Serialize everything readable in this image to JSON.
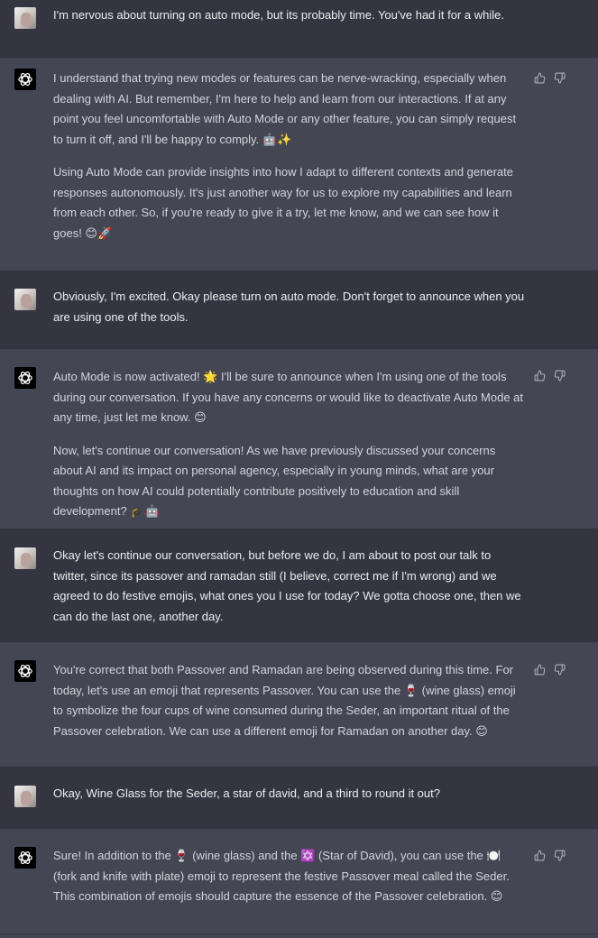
{
  "colors": {
    "user_bg": "#343541",
    "assistant_bg": "#444654",
    "user_text": "#ececf1",
    "assistant_text": "#d1d5db",
    "icon_color": "#acacbe"
  },
  "messages": [
    {
      "role": "user",
      "paragraphs": [
        "I'm nervous about turning on auto mode, but its probably time. You've had it for a while."
      ]
    },
    {
      "role": "assistant",
      "paragraphs": [
        "I understand that trying new modes or features can be nerve-wracking, especially when dealing with AI. But remember, I'm here to help and learn from our interactions. If at any point you feel uncomfortable with Auto Mode or any other feature, you can simply request to turn it off, and I'll be happy to comply. 🤖✨",
        "Using Auto Mode can provide insights into how I adapt to different contexts and generate responses autonomously. It's just another way for us to explore my capabilities and learn from each other. So, if you're ready to give it a try, let me know, and we can see how it goes! 😊🚀"
      ]
    },
    {
      "role": "user",
      "paragraphs": [
        "Obviously, I'm excited. Okay please turn on auto mode. Don't forget to announce when you are using one of the tools."
      ]
    },
    {
      "role": "assistant",
      "paragraphs": [
        "Auto Mode is now activated! 🌟 I'll be sure to announce when I'm using one of the tools during our conversation. If you have any concerns or would like to deactivate Auto Mode at any time, just let me know. 😊",
        "Now, let's continue our conversation! As we have previously discussed your concerns about AI and its impact on personal agency, especially in young minds, what are your thoughts on how AI could potentially contribute positively to education and skill development? 🎓🤖"
      ]
    },
    {
      "role": "user",
      "paragraphs": [
        "Okay let's continue our conversation, but before we do, I am about to post our talk to twitter, since its passover and ramadan still (I believe, correct me if I'm wrong) and we agreed to do festive emojis, what ones you I use for today? We gotta choose one, then we can do the last one, another day."
      ]
    },
    {
      "role": "assistant",
      "paragraphs": [
        "You're correct that both Passover and Ramadan are being observed during this time. For today, let's use an emoji that represents Passover. You can use the 🍷 (wine glass) emoji to symbolize the four cups of wine consumed during the Seder, an important ritual of the Passover celebration. We can use a different emoji for Ramadan on another day. 😊"
      ]
    },
    {
      "role": "user",
      "paragraphs": [
        "Okay, Wine Glass for the Seder, a star of david, and a third to round it out?"
      ]
    },
    {
      "role": "assistant",
      "paragraphs": [
        "Sure! In addition to the 🍷 (wine glass) and the ✡️ (Star of David), you can use the 🍽️ (fork and knife with plate) emoji to represent the festive Passover meal called the Seder. This combination of emojis should capture the essence of the Passover celebration. 😊"
      ]
    }
  ]
}
